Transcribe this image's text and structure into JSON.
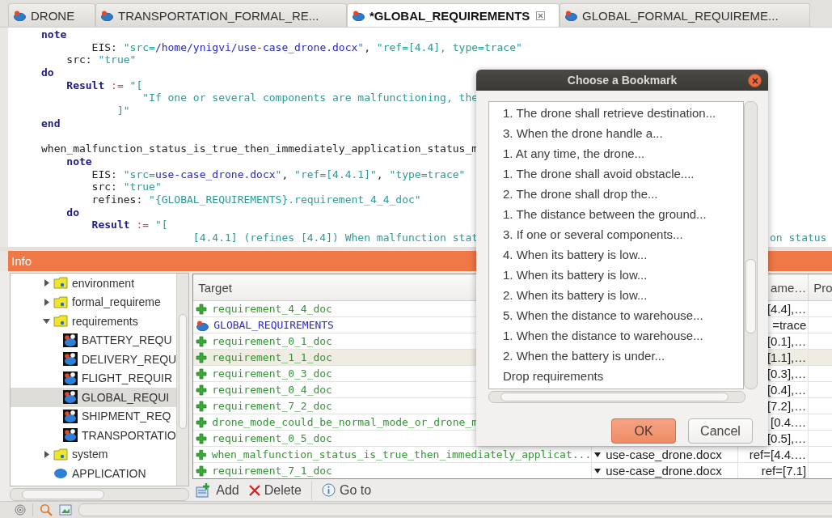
{
  "tabs": [
    {
      "label": "DRONE",
      "selected": false,
      "closable": false
    },
    {
      "label": "TRANSPORTATION_FORMAL_RE...",
      "selected": false,
      "closable": false
    },
    {
      "label": "*GLOBAL_REQUIREMENTS",
      "selected": true,
      "closable": true
    },
    {
      "label": "GLOBAL_FORMAL_REQUIREME...",
      "selected": false,
      "closable": false
    }
  ],
  "editor": {
    "lines": [
      {
        "kind": "code",
        "tokens": [
          {
            "kind": "kw",
            "t": "note"
          }
        ]
      },
      {
        "kind": "code",
        "tokens": [
          {
            "kind": "plain",
            "t": "        EIS: "
          },
          {
            "kind": "str",
            "t": "\"src="
          },
          {
            "kind": "path",
            "t": "/home/ynigvi/use-case_drone.docx"
          },
          {
            "kind": "str",
            "t": "\""
          },
          {
            "kind": "plain",
            "t": ", "
          },
          {
            "kind": "str",
            "t": "\"ref=[4.4], type=trace\""
          }
        ]
      },
      {
        "kind": "code",
        "tokens": [
          {
            "kind": "plain",
            "t": "    src: "
          },
          {
            "kind": "str",
            "t": "\"true\""
          }
        ]
      },
      {
        "kind": "code",
        "tokens": [
          {
            "kind": "kw",
            "t": "do"
          }
        ]
      },
      {
        "kind": "code",
        "tokens": [
          {
            "kind": "kw",
            "t": "    Result"
          },
          {
            "kind": "op",
            "t": " := "
          },
          {
            "kind": "str",
            "t": "\"["
          }
        ]
      },
      {
        "kind": "code",
        "tokens": [
          {
            "kind": "str",
            "t": "                \"If one or several components are malfunctioning, the"
          }
        ]
      },
      {
        "kind": "code",
        "tokens": [
          {
            "kind": "str",
            "t": "            ]\""
          }
        ]
      },
      {
        "kind": "code",
        "tokens": [
          {
            "kind": "kw",
            "t": "end"
          }
        ]
      },
      {
        "kind": "blank"
      },
      {
        "kind": "code",
        "tokens": [
          {
            "kind": "plain",
            "t": "when_malfunction_status_is_true_then_immediately_application_status_m"
          }
        ]
      },
      {
        "kind": "code",
        "tokens": [
          {
            "kind": "kw",
            "t": "    note"
          }
        ]
      },
      {
        "kind": "code",
        "tokens": [
          {
            "kind": "plain",
            "t": "        EIS: "
          },
          {
            "kind": "str",
            "t": "\"src="
          },
          {
            "kind": "path",
            "t": "use-case_drone.docx"
          },
          {
            "kind": "str",
            "t": "\""
          },
          {
            "kind": "plain",
            "t": ", "
          },
          {
            "kind": "str",
            "t": "\"ref=[4.4.1]\""
          },
          {
            "kind": "plain",
            "t": ", "
          },
          {
            "kind": "str",
            "t": "\"type=trace\""
          }
        ]
      },
      {
        "kind": "code",
        "tokens": [
          {
            "kind": "plain",
            "t": "        src: "
          },
          {
            "kind": "str",
            "t": "\"true\""
          }
        ]
      },
      {
        "kind": "code",
        "tokens": [
          {
            "kind": "plain",
            "t": "        refines: "
          },
          {
            "kind": "str",
            "t": "\"{GLOBAL_REQUIREMENTS}.requirement_4_4_doc\""
          }
        ]
      },
      {
        "kind": "code",
        "tokens": [
          {
            "kind": "kw",
            "t": "    do"
          }
        ]
      },
      {
        "kind": "code",
        "tokens": [
          {
            "kind": "kw",
            "t": "        Result"
          },
          {
            "kind": "op",
            "t": " := "
          },
          {
            "kind": "str",
            "t": "\"["
          }
        ]
      },
      {
        "kind": "code",
        "tokens": [
          {
            "kind": "str",
            "t": "                        [4.4.1] (refines [4.4]) When malfunction stat"
          }
        ],
        "resume": "on status"
      }
    ]
  },
  "info_panel": {
    "title": "Info",
    "tree": {
      "items": [
        {
          "label": "environment",
          "kind": "folder",
          "expanded": false,
          "selected": false
        },
        {
          "label": "formal_requireme",
          "kind": "folder",
          "expanded": false,
          "selected": false
        },
        {
          "label": "requirements",
          "kind": "folder",
          "expanded": true,
          "selected": false,
          "children": [
            {
              "label": "BATTERY_REQU",
              "kind": "module",
              "selected": false
            },
            {
              "label": "DELIVERY_REQU",
              "kind": "module",
              "selected": false
            },
            {
              "label": "FLIGHT_REQUIR",
              "kind": "module",
              "selected": false
            },
            {
              "label": "GLOBAL_REQUI",
              "kind": "module",
              "selected": true
            },
            {
              "label": "SHIPMENT_REQ",
              "kind": "module",
              "selected": false
            },
            {
              "label": "TRANSPORTATIO",
              "kind": "module",
              "selected": false
            }
          ]
        },
        {
          "label": "system",
          "kind": "folder",
          "expanded": false,
          "selected": false
        },
        {
          "label": "APPLICATION",
          "kind": "application",
          "selected": false
        }
      ]
    },
    "table": {
      "columns": [
        "Target",
        "ame…",
        "Pro"
      ],
      "rows": [
        {
          "target": "requirement_4_4_doc",
          "kind": "requirement",
          "selected": false,
          "column_3": "[4.4],…"
        },
        {
          "target": "GLOBAL_REQUIREMENTS",
          "kind": "module",
          "selected": false,
          "column_3": "=trace"
        },
        {
          "target": "requirement_0_1_doc",
          "kind": "requirement",
          "selected": false,
          "column_3": "[0.1],…"
        },
        {
          "target": "requirement_1_1_doc",
          "kind": "requirement",
          "selected": true,
          "column_3": "[1.1],…"
        },
        {
          "target": "requirement_0_3_doc",
          "kind": "requirement",
          "selected": false,
          "column_3": "[0.3],…"
        },
        {
          "target": "requirement_0_4_doc",
          "kind": "requirement",
          "selected": false,
          "column_3": "[0.4],…"
        },
        {
          "target": "requirement_7_2_doc",
          "kind": "requirement",
          "selected": false,
          "column_3": "[7.2],…"
        },
        {
          "target": "drone_mode_could_be_normal_mode_or_drone_m",
          "kind": "requirement",
          "selected": false,
          "column_3": "[0.4.…"
        },
        {
          "target": "requirement_0_5_doc",
          "kind": "requirement",
          "selected": false,
          "column_3": "[0.5],…"
        },
        {
          "target": "when_malfunction_status_is_true_then_immediately_applicat...",
          "kind": "requirement",
          "selected": false,
          "column_2": "use-case_drone.docx",
          "column_3": "ref=[4.4.…"
        },
        {
          "target": "requirement_7_1_doc",
          "kind": "requirement",
          "selected": false,
          "column_2": "use-case_drone.docx",
          "column_3": "ref=[7.1]"
        }
      ]
    },
    "toolbar": [
      {
        "label": "Add",
        "kind": "add"
      },
      {
        "label": "Delete",
        "kind": "delete"
      },
      {
        "label": "Go to",
        "kind": "goto"
      }
    ]
  },
  "dialog": {
    "title": "Choose a Bookmark",
    "items": [
      {
        "label": "1. The drone shall retrieve destination...",
        "selected": false
      },
      {
        "label": "3. When the drone handle a...",
        "selected": false
      },
      {
        "label": "1. At any time, the drone...",
        "selected": false
      },
      {
        "label": "1. The drone shall avoid obstacle....",
        "selected": false
      },
      {
        "label": "2. The drone shall drop the...",
        "selected": false
      },
      {
        "label": "1. The distance between the ground...",
        "selected": false
      },
      {
        "label": "3. If one or several components...",
        "selected": false
      },
      {
        "label": "4. When its battery is low...",
        "selected": false
      },
      {
        "label": "1. When its battery is low...",
        "selected": false
      },
      {
        "label": "2. When its battery is low...",
        "selected": false
      },
      {
        "label": "5. When the distance to warehouse...",
        "selected": false
      },
      {
        "label": "1. When the distance to warehouse...",
        "selected": false
      },
      {
        "label": "2. When the battery is under...",
        "selected": false
      },
      {
        "label": "Drop requirements",
        "selected": false
      }
    ],
    "buttons": [
      {
        "label": "OK",
        "primary": true
      },
      {
        "label": "Cancel",
        "primary": false
      }
    ]
  }
}
